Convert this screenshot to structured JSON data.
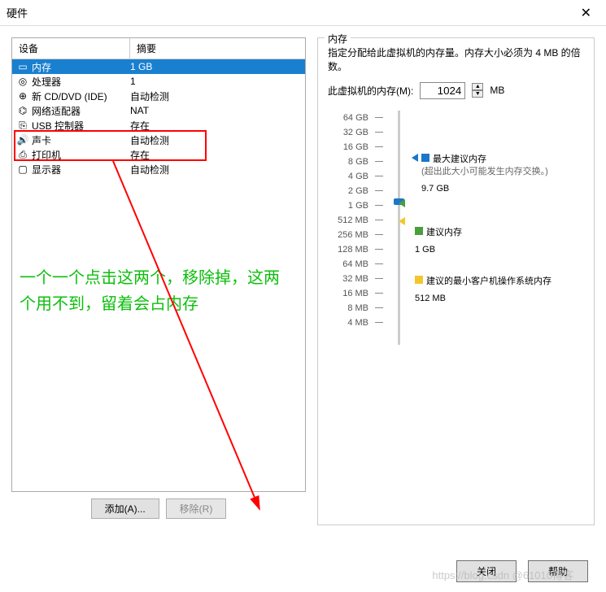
{
  "window": {
    "title": "硬件"
  },
  "table": {
    "headers": {
      "device": "设备",
      "summary": "摘要"
    },
    "rows": [
      {
        "name": "内存",
        "summary": "1 GB",
        "selected": true,
        "icon": "memory"
      },
      {
        "name": "处理器",
        "summary": "1",
        "selected": false,
        "icon": "cpu"
      },
      {
        "name": "新 CD/DVD (IDE)",
        "summary": "自动检测",
        "selected": false,
        "icon": "cd"
      },
      {
        "name": "网络适配器",
        "summary": "NAT",
        "selected": false,
        "icon": "network"
      },
      {
        "name": "USB 控制器",
        "summary": "存在",
        "selected": false,
        "icon": "usb"
      },
      {
        "name": "声卡",
        "summary": "自动检测",
        "selected": false,
        "icon": "sound"
      },
      {
        "name": "打印机",
        "summary": "存在",
        "selected": false,
        "icon": "printer"
      },
      {
        "name": "显示器",
        "summary": "自动检测",
        "selected": false,
        "icon": "display"
      }
    ]
  },
  "annotation": "一个一个点击这两个，移除掉，这两个用不到，留着会占内存",
  "buttons": {
    "add": "添加(A)...",
    "remove": "移除(R)"
  },
  "mem_panel": {
    "title": "内存",
    "desc": "指定分配给此虚拟机的内存量。内存大小必须为 4 MB 的倍数。",
    "label": "此虚拟机的内存(M):",
    "value": "1024",
    "unit": "MB",
    "ticks": [
      "64 GB",
      "32 GB",
      "16 GB",
      "8 GB",
      "4 GB",
      "2 GB",
      "1 GB",
      "512 MB",
      "256 MB",
      "128 MB",
      "64 MB",
      "32 MB",
      "16 MB",
      "8 MB",
      "4 MB"
    ],
    "max_label": "最大建议内存",
    "max_note": "(超出此大小可能发生内存交换。)",
    "max_val": "9.7 GB",
    "rec_label": "建议内存",
    "rec_val": "1 GB",
    "min_label": "建议的最小客户机操作系统内存",
    "min_val": "512 MB"
  },
  "footer": {
    "close": "关闭",
    "help": "帮助"
  },
  "watermark": "https://blog.csdn @61010博客"
}
